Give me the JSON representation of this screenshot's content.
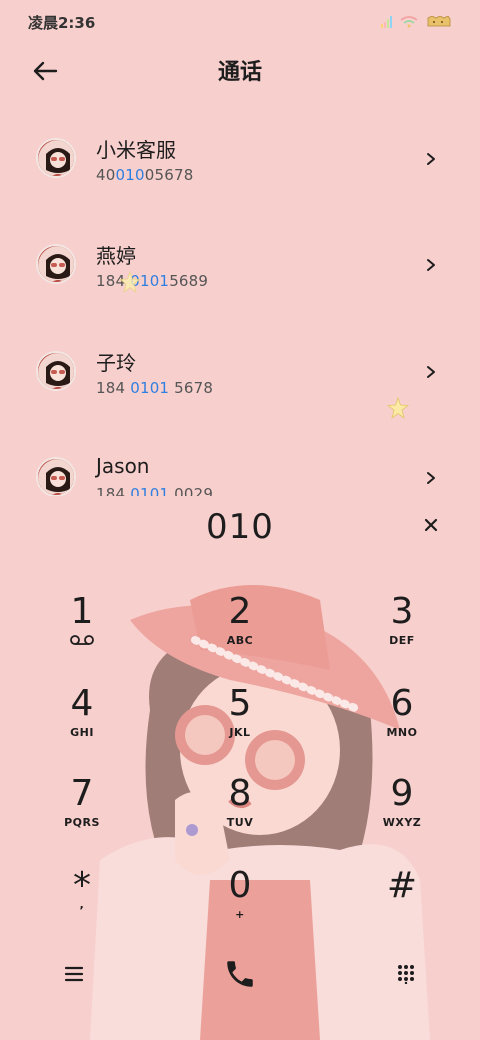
{
  "status_bar": {
    "time": "凌晨2:36",
    "signal_colors": [
      "#ffd27a",
      "#ffb8b8",
      "#c7e89a",
      "#8fd3f4"
    ],
    "wifi_color": "#f2a1a1",
    "battery_color": "#e8c16a",
    "icons": [
      "signal-icon",
      "wifi-icon",
      "battery-icon"
    ]
  },
  "header": {
    "title": "通话",
    "back_icon": "arrow-left-icon"
  },
  "contacts": [
    {
      "name": "小米客服",
      "number_parts": [
        "40",
        "010",
        "05678"
      ]
    },
    {
      "name": "燕婷",
      "number_parts": [
        "184 ",
        "0101",
        "5689"
      ]
    },
    {
      "name": "子玲",
      "number_parts": [
        "184 ",
        "0101",
        " 5678"
      ]
    },
    {
      "name": "Jason",
      "number_parts": [
        "184 ",
        "0101",
        " 0029"
      ]
    }
  ],
  "dialer": {
    "input": "010",
    "clear_icon": "close-icon"
  },
  "keypad": [
    {
      "digit": "1",
      "letters": "",
      "sub_icon": "voicemail-icon"
    },
    {
      "digit": "2",
      "letters": "ABC"
    },
    {
      "digit": "3",
      "letters": "DEF"
    },
    {
      "digit": "4",
      "letters": "GHI"
    },
    {
      "digit": "5",
      "letters": "JKL"
    },
    {
      "digit": "6",
      "letters": "MNO"
    },
    {
      "digit": "7",
      "letters": "PQRS"
    },
    {
      "digit": "8",
      "letters": "TUV"
    },
    {
      "digit": "9",
      "letters": "WXYZ"
    },
    {
      "digit": "*",
      "letters": ","
    },
    {
      "digit": "0",
      "letters": "+"
    },
    {
      "digit": "#",
      "letters": ""
    }
  ],
  "bottom_bar": {
    "icons": [
      "menu-icon",
      "phone-call-icon",
      "keypad-toggle-icon"
    ]
  },
  "colors": {
    "background": "#f7cfcd",
    "highlight": "#2f7fe0",
    "text": "#1d1d1d"
  }
}
